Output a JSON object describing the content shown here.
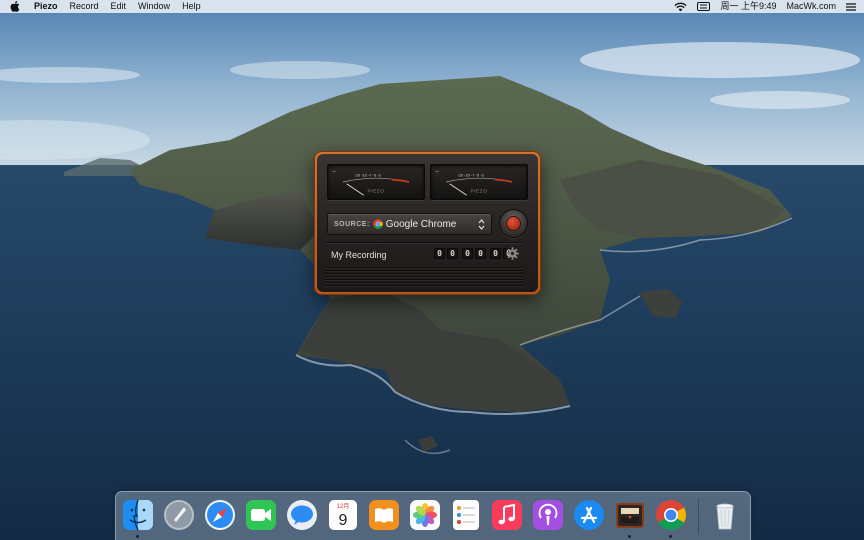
{
  "menubar": {
    "app_name": "Piezo",
    "menus": [
      "Record",
      "Edit",
      "Window",
      "Help"
    ],
    "clock": "周一 上午9:49",
    "site": "MacWk.com"
  },
  "piezo": {
    "meter_brand": "PIEZO",
    "meter_scale": "-20 -10 -7 -5 -3",
    "source_label": "SOURCE:",
    "source_value": "Google Chrome",
    "recording_name": "My Recording",
    "timer_digits": [
      "0",
      "0",
      "0",
      "0",
      "0",
      "0"
    ]
  },
  "dock": {
    "calendar_month": "12月",
    "calendar_day": "9"
  },
  "colors": {
    "piezo_frame": "#c8621f",
    "record_red": "#c63a22",
    "menubar_bg": "#ecf0f5"
  },
  "icons": {
    "menubar": [
      "apple-icon",
      "wifi-icon",
      "input-method-icon",
      "menu-list-icon"
    ],
    "dock": [
      "finder-icon",
      "launchpad-icon",
      "safari-icon",
      "facetime-icon",
      "messages-icon",
      "calendar-icon",
      "books-icon",
      "photos-icon",
      "reminders-icon",
      "music-icon",
      "podcasts-icon",
      "app-store-icon",
      "piezo-icon",
      "chrome-icon",
      "trash-icon"
    ]
  }
}
